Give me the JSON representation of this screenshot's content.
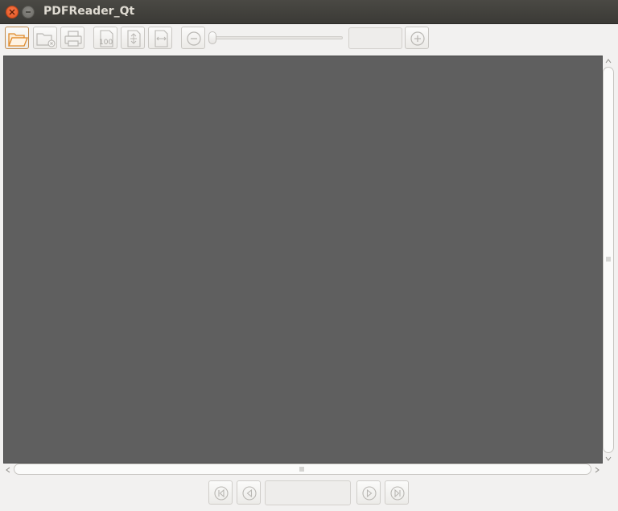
{
  "window": {
    "title": "PDFReader_Qt",
    "close_icon": "close-icon",
    "minimize_icon": "minimize-icon"
  },
  "toolbar": {
    "buttons": [
      {
        "id": "open",
        "icon": "folder-open-icon",
        "enabled": true,
        "accent": "#e08a2b"
      },
      {
        "id": "close-document",
        "icon": "folder-close-icon",
        "enabled": false
      },
      {
        "id": "print",
        "icon": "printer-icon",
        "enabled": false
      },
      {
        "id": "actual-size",
        "icon": "zoom-100-icon",
        "label": "100",
        "enabled": false
      },
      {
        "id": "fit-page",
        "icon": "fit-page-icon",
        "enabled": false
      },
      {
        "id": "fit-width",
        "icon": "fit-width-icon",
        "enabled": false
      },
      {
        "id": "zoom-out",
        "icon": "zoom-out-icon",
        "enabled": false
      },
      {
        "id": "zoom-in",
        "icon": "zoom-in-icon",
        "enabled": false
      }
    ],
    "zoom_value": "",
    "zoom_slider_level": 0
  },
  "viewer": {
    "background": "#5f5f5f"
  },
  "navigation": {
    "buttons": [
      {
        "id": "first-page",
        "icon": "first-page-icon",
        "enabled": false
      },
      {
        "id": "previous-page",
        "icon": "previous-page-icon",
        "enabled": false
      },
      {
        "id": "next-page",
        "icon": "next-page-icon",
        "enabled": false
      },
      {
        "id": "last-page",
        "icon": "last-page-icon",
        "enabled": false
      }
    ],
    "page_value": ""
  },
  "colors": {
    "titlebar": "#3f3e3a",
    "window_bg": "#f2f1f0",
    "close_button": "#e95420",
    "disabled_icon": "#b9b7b3"
  }
}
